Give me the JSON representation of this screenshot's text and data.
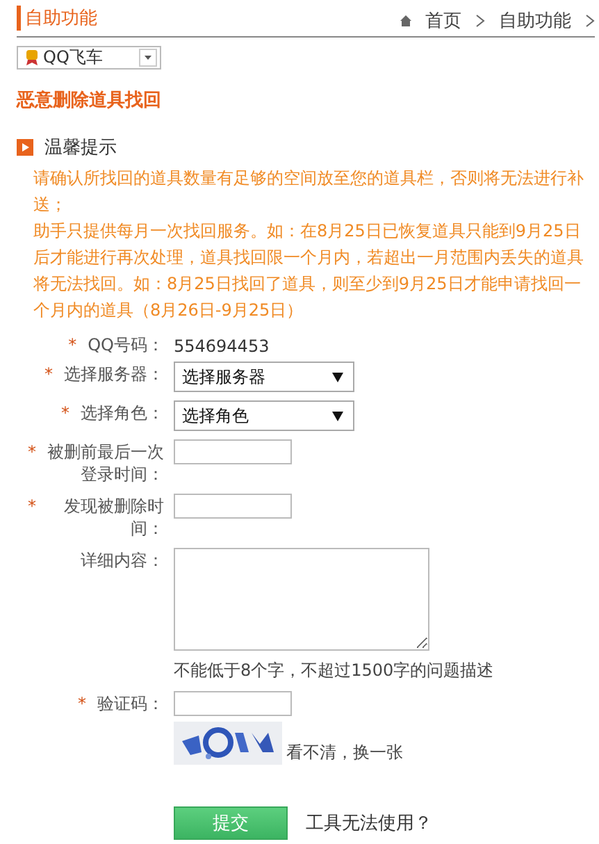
{
  "header": {
    "title": "自助功能",
    "breadcrumb": [
      {
        "label": "首页"
      },
      {
        "label": "自助功能"
      }
    ]
  },
  "game_select": {
    "value": "QQ飞车"
  },
  "page_title": "恶意删除道具找回",
  "notice": {
    "title": "温馨提示",
    "paragraphs": [
      "请确认所找回的道具数量有足够的空间放至您的道具栏，否则将无法进行补送；",
      "助手只提供每月一次找回服务。如：在8月25日已恢复道具只能到9月25日后才能进行再次处理，道具找回限一个月内，若超出一月范围内丢失的道具将无法找回。如：8月25日找回了道具，则至少到9月25日才能申请找回一个月内的道具（8月26日-9月25日）"
    ]
  },
  "form": [
    {
      "kind": "static",
      "mark": "*",
      "label": "QQ号码：",
      "value": "554694453"
    },
    {
      "kind": "select",
      "mark": "*",
      "label": "选择服务器：",
      "value": "选择服务器"
    },
    {
      "kind": "select",
      "mark": "*",
      "label": "选择角色：",
      "value": "选择角色"
    },
    {
      "kind": "input",
      "mark": "*",
      "label": "被删前最后一次登录时间："
    },
    {
      "kind": "input",
      "mark": "*",
      "label": "发现被删除时间："
    },
    {
      "kind": "textarea",
      "label": "详细内容：",
      "hint": "不能低于8个字，不超过1500字的问题描述"
    },
    {
      "kind": "input",
      "mark": "*",
      "label": "验证码："
    },
    {
      "kind": "captcha",
      "link": "看不清，换一张"
    }
  ],
  "submit": "提交",
  "help_link": "工具无法使用？"
}
